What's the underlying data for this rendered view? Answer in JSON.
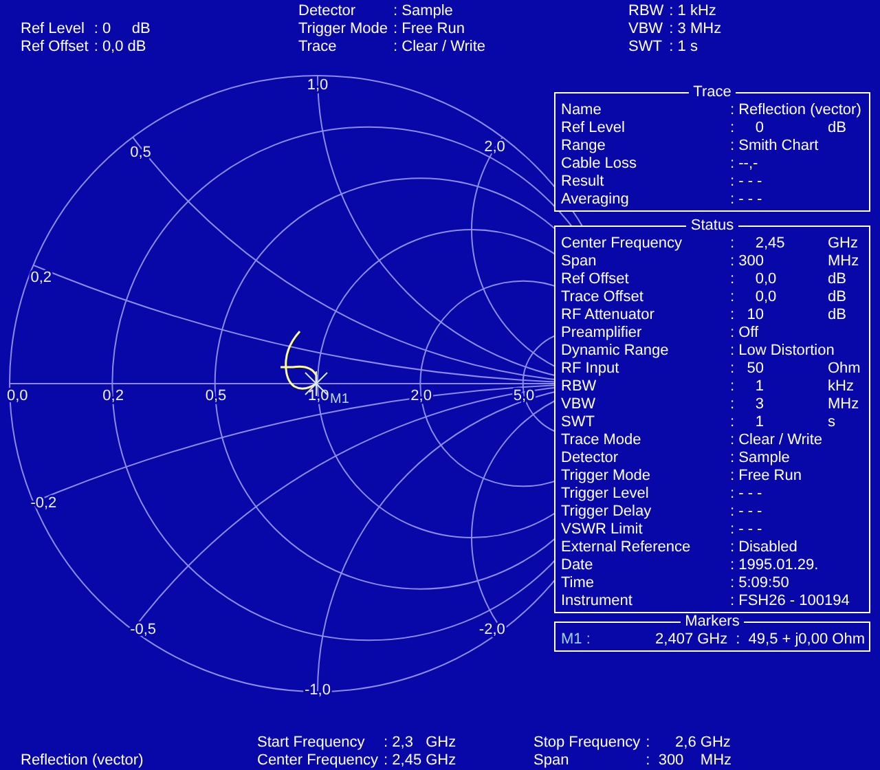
{
  "header": {
    "left": [
      {
        "label": "Ref Level",
        "value": ": 0     dB"
      },
      {
        "label": "Ref Offset",
        "value": ": 0,0 dB"
      }
    ],
    "center": [
      {
        "label": "Detector",
        "value": ": Sample"
      },
      {
        "label": "Trigger Mode",
        "value": ": Free Run"
      },
      {
        "label": "Trace",
        "value": ": Clear / Write"
      }
    ],
    "right": [
      {
        "label": "RBW",
        "value": ": 1 kHz"
      },
      {
        "label": "VBW",
        "value": ": 3 MHz"
      },
      {
        "label": "SWT",
        "value": ": 1 s"
      }
    ]
  },
  "smith_chart": {
    "resistance_labels": [
      "0,0",
      "0,2",
      "0,5",
      "1,0",
      "2,0",
      "5,0"
    ],
    "reactance_labels": [
      "1,0",
      "0,5",
      "2,0",
      "0,2",
      "-0,2",
      "-0,5",
      "-2,0",
      "-1,0"
    ],
    "marker": {
      "label": "M1"
    }
  },
  "trace_panel": {
    "title": "Trace",
    "rows": [
      {
        "label": "Name",
        "value": ": Reflection (vector)"
      },
      {
        "label": "Ref Level",
        "value": ":     0",
        "unit": "dB"
      },
      {
        "label": "Range",
        "value": ": Smith Chart"
      },
      {
        "label": "Cable Loss",
        "value": ": --,-"
      },
      {
        "label": "Result",
        "value": ": - - -"
      },
      {
        "label": "Averaging",
        "value": ": - - -"
      }
    ]
  },
  "status_panel": {
    "title": "Status",
    "rows": [
      {
        "label": "Center Frequency",
        "value": ":     2,45",
        "unit": "GHz"
      },
      {
        "label": "Span",
        "value": ": 300",
        "unit": "MHz"
      },
      {
        "label": "Ref Offset",
        "value": ":     0,0",
        "unit": "dB"
      },
      {
        "label": "Trace Offset",
        "value": ":     0,0",
        "unit": "dB"
      },
      {
        "label": "RF Attenuator",
        "value": ":   10",
        "unit": "dB"
      },
      {
        "label": "Preamplifier",
        "value": ": Off"
      },
      {
        "label": "Dynamic Range",
        "value": ": Low Distortion"
      },
      {
        "label": "RF Input",
        "value": ":   50",
        "unit": "Ohm"
      },
      {
        "label": "RBW",
        "value": ":     1",
        "unit": "kHz"
      },
      {
        "label": "VBW",
        "value": ":     3",
        "unit": "MHz"
      },
      {
        "label": "SWT",
        "value": ":     1",
        "unit": "s"
      },
      {
        "label": "Trace Mode",
        "value": ": Clear / Write"
      },
      {
        "label": "Detector",
        "value": ": Sample"
      },
      {
        "label": "Trigger Mode",
        "value": ": Free Run"
      },
      {
        "label": "Trigger Level",
        "value": ": - - -"
      },
      {
        "label": "Trigger Delay",
        "value": ": - - -"
      },
      {
        "label": "VSWR Limit",
        "value": ": - - -"
      },
      {
        "label": "External Reference",
        "value": ": Disabled"
      },
      {
        "label": "Date",
        "value": ": 1995.01.29."
      },
      {
        "label": "Time",
        "value": ": 5:09:50"
      },
      {
        "label": "Instrument",
        "value": ": FSH26 - 100194"
      }
    ]
  },
  "markers_panel": {
    "title": "Markers",
    "markers": [
      {
        "label": "M1 :",
        "frequency": "2,407 GHz",
        "value": ":  49,5 + j0,00 Ohm"
      }
    ]
  },
  "footer": {
    "mode": "Reflection (vector)",
    "center": [
      {
        "label": "Start Frequency",
        "value": ": 2,3   GHz"
      },
      {
        "label": "Center Frequency",
        "value": ": 2,45 GHz"
      }
    ],
    "right": [
      {
        "label": "Stop Frequency",
        "value": ":      2,6 GHz"
      },
      {
        "label": "Span",
        "value": ":  300    MHz"
      }
    ]
  }
}
